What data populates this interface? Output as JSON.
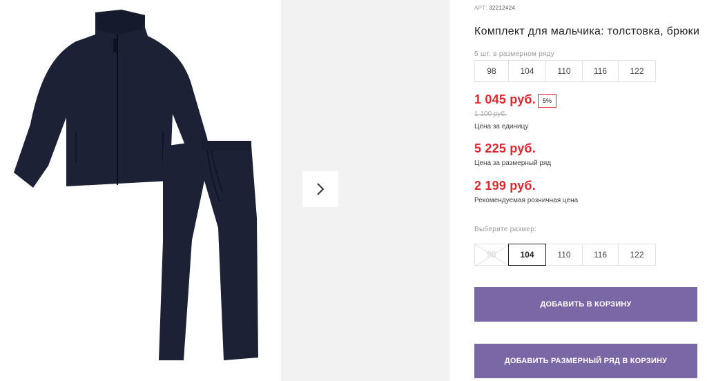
{
  "product": {
    "art_label": "АРТ:",
    "art_value": "32212424",
    "title": "Комплект для мальчика: толстовка, брюки",
    "row_note": "5 шт. в размерном ряду",
    "size_row": [
      "98",
      "104",
      "110",
      "116",
      "122"
    ],
    "discount_badge": "5%",
    "unit_price": "1 045 руб.",
    "old_price": "1 100 руб.",
    "unit_price_note": "Цена за единицу",
    "row_price": "5 225 руб.",
    "row_price_note": "Цена за размерный ряд",
    "retail_price": "2 199 руб.",
    "retail_price_note": "Рекомендуемая розничная цена",
    "choose_size_label": "Выберите размер:",
    "size_options": [
      {
        "label": "98",
        "state": "disabled"
      },
      {
        "label": "104",
        "state": "selected"
      },
      {
        "label": "110",
        "state": "available"
      },
      {
        "label": "116",
        "state": "available"
      },
      {
        "label": "122",
        "state": "available"
      }
    ],
    "add_to_cart": "ДОБАВИТЬ В КОРЗИНУ",
    "add_row_to_cart": "ДОБАВИТЬ РАЗМЕРНЫЙ РЯД В КОРЗИНУ"
  },
  "gallery": {
    "next_icon": "chevron-right-icon"
  },
  "colors": {
    "price_red": "#e3262f",
    "button_purple": "#7a68a6",
    "garment_navy": "#1b2035"
  }
}
